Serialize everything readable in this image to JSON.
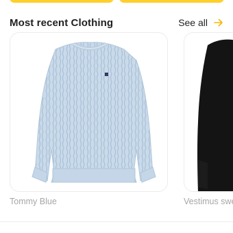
{
  "section": {
    "title": "Most recent Clothing",
    "see_all_label": "See all"
  },
  "products": [
    {
      "name": "Tommy Blue",
      "image": "light-blue-cable-knit-sweater"
    },
    {
      "name": "Vestimus swe",
      "image": "black-sweater"
    }
  ],
  "colors": {
    "accent": "#FFD02B",
    "arrow": "#F5B800",
    "sweater_blue": "#C9DAEA",
    "sweater_black": "#141414"
  }
}
